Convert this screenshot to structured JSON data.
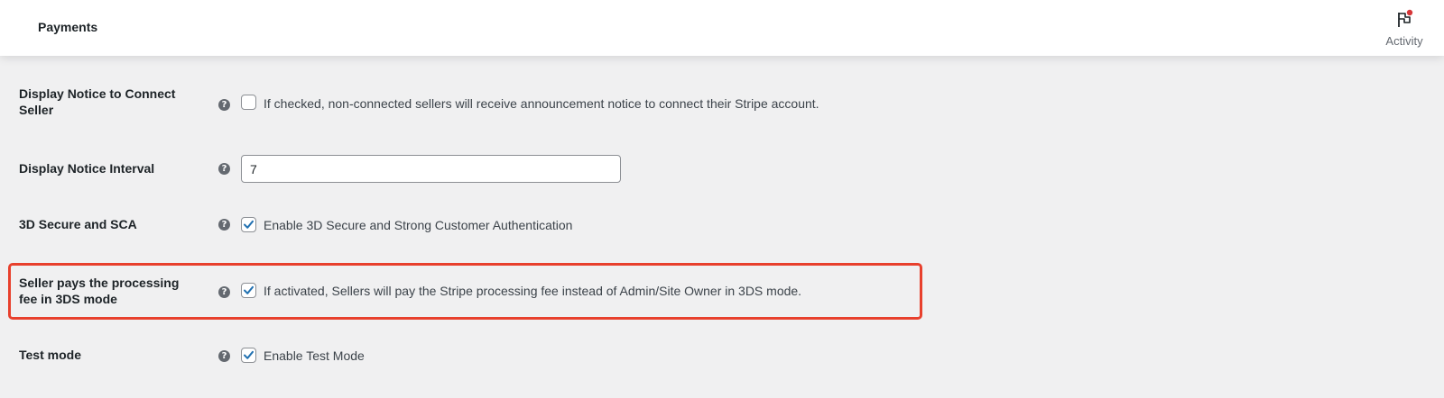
{
  "header": {
    "title": "Payments",
    "activity_label": "Activity",
    "activity_icon": "flag-icon",
    "activity_badge_color": "#d63638"
  },
  "settings": [
    {
      "label": "Display Notice to Connect Seller",
      "control": "checkbox",
      "checked": false,
      "description": "If checked, non-connected sellers will receive announcement notice to connect their Stripe account."
    },
    {
      "label": "Display Notice Interval",
      "control": "text",
      "value": "7"
    },
    {
      "label": "3D Secure and SCA",
      "control": "checkbox",
      "checked": true,
      "description": "Enable 3D Secure and Strong Customer Authentication"
    },
    {
      "label": "Seller pays the processing fee in 3DS mode",
      "control": "checkbox",
      "checked": true,
      "highlighted": true,
      "description": "If activated, Sellers will pay the Stripe processing fee instead of Admin/Site Owner in 3DS mode."
    },
    {
      "label": "Test mode",
      "control": "checkbox",
      "checked": true,
      "description": "Enable Test Mode"
    }
  ],
  "colors": {
    "accent": "#2271b1",
    "highlight_border": "#e8402d",
    "background": "#f0f0f1"
  }
}
